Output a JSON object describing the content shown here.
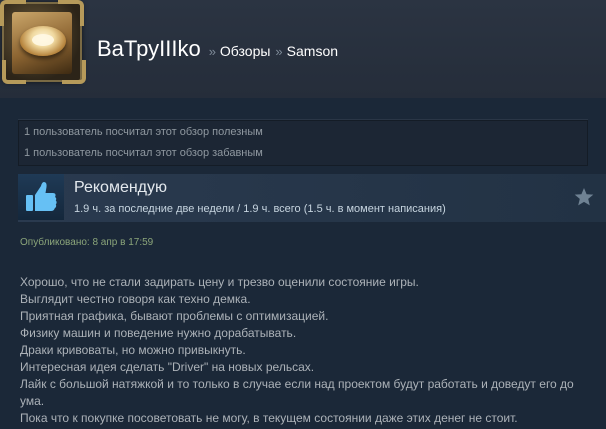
{
  "header": {
    "username": "BaТруIIIko",
    "separator": "»",
    "breadcrumbs": [
      "Обзоры",
      "Samson"
    ]
  },
  "ratings": {
    "helpful": "1 пользователь посчитал этот обзор полезным",
    "funny": "1 пользователь посчитал этот обзор забавным"
  },
  "recommendation": {
    "title": "Рекомендую",
    "hours": "1.9 ч. за последние две недели / 1.9 ч. всего (1.5 ч. в момент написания)",
    "icon": "thumbs-up-icon",
    "award_icon": "star-icon"
  },
  "posted": "Опубликовано: 8 апр в 17:59",
  "review_lines": [
    "Хорошо, что не стали задирать цену и трезво оценили состояние игры.",
    "Выглядит честно говоря как техно демка.",
    "Приятная графика, бывают проблемы с оптимизацией.",
    "Физику машин и поведение нужно дорабатывать.",
    "Драки кривоваты, но можно привыкнуть.",
    "Интересная идея сделать \"Driver\" на новых рельсах.",
    "Лайк с большой натяжкой и то только в случае если над проектом будут работать и доведут его до ума.",
    "Пока что к покупке посоветовать не могу, в текущем состоянии даже этих денег не стоит."
  ],
  "colors": {
    "background": "#1b2838",
    "accent_blue": "#66c0f4",
    "posted_green": "#8ba57a"
  }
}
